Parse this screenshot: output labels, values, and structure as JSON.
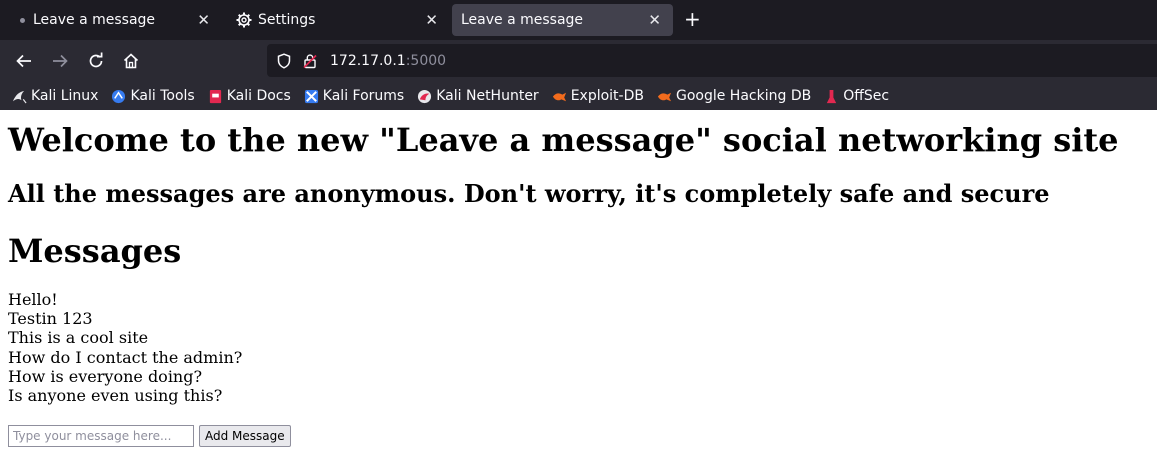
{
  "tabs": [
    {
      "title": "Leave a message",
      "active": false,
      "icon": "dot-icon"
    },
    {
      "title": "Settings",
      "active": false,
      "icon": "gear-icon"
    },
    {
      "title": "Leave a message",
      "active": true,
      "icon": "none"
    }
  ],
  "tab_close_symbol": "✕",
  "new_tab_symbol": "+",
  "url": {
    "host": "172.17.0.1",
    "port": ":5000"
  },
  "bookmarks": [
    {
      "label": "Kali Linux",
      "icon": "kali-dragon-icon"
    },
    {
      "label": "Kali Tools",
      "icon": "kali-tools-icon"
    },
    {
      "label": "Kali Docs",
      "icon": "kali-docs-icon"
    },
    {
      "label": "Kali Forums",
      "icon": "kali-forums-icon"
    },
    {
      "label": "Kali NetHunter",
      "icon": "nethunter-icon"
    },
    {
      "label": "Exploit-DB",
      "icon": "exploit-db-icon"
    },
    {
      "label": "Google Hacking DB",
      "icon": "ghdb-icon"
    },
    {
      "label": "OffSec",
      "icon": "offsec-icon"
    }
  ],
  "page": {
    "heading": "Welcome to the new \"Leave a message\" social networking site",
    "subheading": "All the messages are anonymous. Don't worry, it's completely safe and secure",
    "messages_heading": "Messages",
    "messages": [
      "Hello!",
      "Testin 123",
      "This is a cool site",
      "How do I contact the admin?",
      "How is everyone doing?",
      "Is anyone even using this?"
    ],
    "input_placeholder": "Type your message here...",
    "button_label": "Add Message"
  },
  "colors": {
    "chrome_dark": "#1c1b22",
    "chrome": "#2b2a33",
    "active_tab": "#42414d",
    "text_light": "#fbfbfe"
  }
}
